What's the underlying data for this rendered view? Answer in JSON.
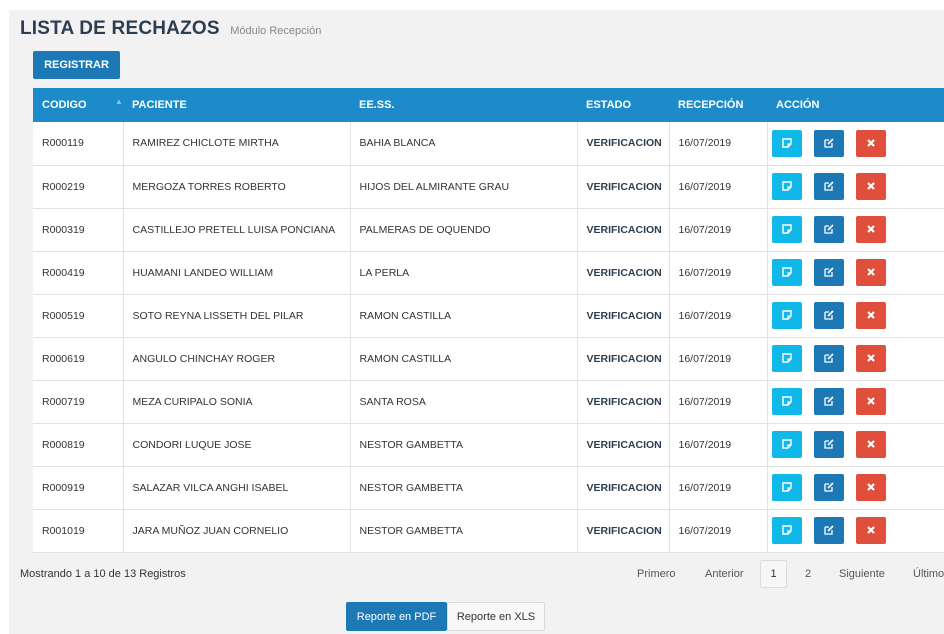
{
  "header": {
    "title": "LISTA DE RECHAZOS",
    "subtitle": "Módulo Recepción"
  },
  "actions": {
    "register_label": "REGISTRAR"
  },
  "table": {
    "columns": [
      "CODIGO",
      "PACIENTE",
      "EE.SS.",
      "ESTADO",
      "RECEPCIÓN",
      "ACCIÓN"
    ],
    "sorted_column": "CODIGO",
    "rows": [
      {
        "codigo": "R000119",
        "paciente": "RAMIREZ CHICLOTE MIRTHA",
        "eess": "BAHIA BLANCA",
        "estado": "VERIFICACION",
        "recepcion": "16/07/2019"
      },
      {
        "codigo": "R000219",
        "paciente": "MERGOZA TORRES ROBERTO",
        "eess": "HIJOS DEL ALMIRANTE GRAU",
        "estado": "VERIFICACION",
        "recepcion": "16/07/2019"
      },
      {
        "codigo": "R000319",
        "paciente": "CASTILLEJO PRETELL LUISA PONCIANA",
        "eess": "PALMERAS DE OQUENDO",
        "estado": "VERIFICACION",
        "recepcion": "16/07/2019"
      },
      {
        "codigo": "R000419",
        "paciente": "HUAMANI LANDEO WILLIAM",
        "eess": "LA PERLA",
        "estado": "VERIFICACION",
        "recepcion": "16/07/2019"
      },
      {
        "codigo": "R000519",
        "paciente": "SOTO REYNA LISSETH DEL PILAR",
        "eess": "RAMON CASTILLA",
        "estado": "VERIFICACION",
        "recepcion": "16/07/2019"
      },
      {
        "codigo": "R000619",
        "paciente": "ANGULO CHINCHAY ROGER",
        "eess": "RAMON CASTILLA",
        "estado": "VERIFICACION",
        "recepcion": "16/07/2019"
      },
      {
        "codigo": "R000719",
        "paciente": "MEZA CURIPALO SONIA",
        "eess": "SANTA ROSA",
        "estado": "VERIFICACION",
        "recepcion": "16/07/2019"
      },
      {
        "codigo": "R000819",
        "paciente": "CONDORI LUQUE JOSE",
        "eess": "NESTOR GAMBETTA",
        "estado": "VERIFICACION",
        "recepcion": "16/07/2019"
      },
      {
        "codigo": "R000919",
        "paciente": "SALAZAR VILCA ANGHI ISABEL",
        "eess": "NESTOR GAMBETTA",
        "estado": "VERIFICACION",
        "recepcion": "16/07/2019"
      },
      {
        "codigo": "R001019",
        "paciente": "JARA MUÑOZ JUAN CORNELIO",
        "eess": "NESTOR GAMBETTA",
        "estado": "VERIFICACION",
        "recepcion": "16/07/2019"
      }
    ],
    "row_actions": [
      "view-icon",
      "edit-icon",
      "delete-icon"
    ]
  },
  "footer": {
    "info": "Mostrando 1 a 10 de 13 Registros",
    "pagination": {
      "first": "Primero",
      "prev": "Anterior",
      "pages": [
        "1",
        "2"
      ],
      "current": "1",
      "next": "Siguiente",
      "last": "Último"
    },
    "report_pdf": "Reporte en PDF",
    "report_xls": "Reporte en XLS"
  },
  "colors": {
    "header_bg": "#1d8ac9",
    "primary": "#1d79b5",
    "view": "#11b8ea",
    "delete": "#e04e3c"
  }
}
